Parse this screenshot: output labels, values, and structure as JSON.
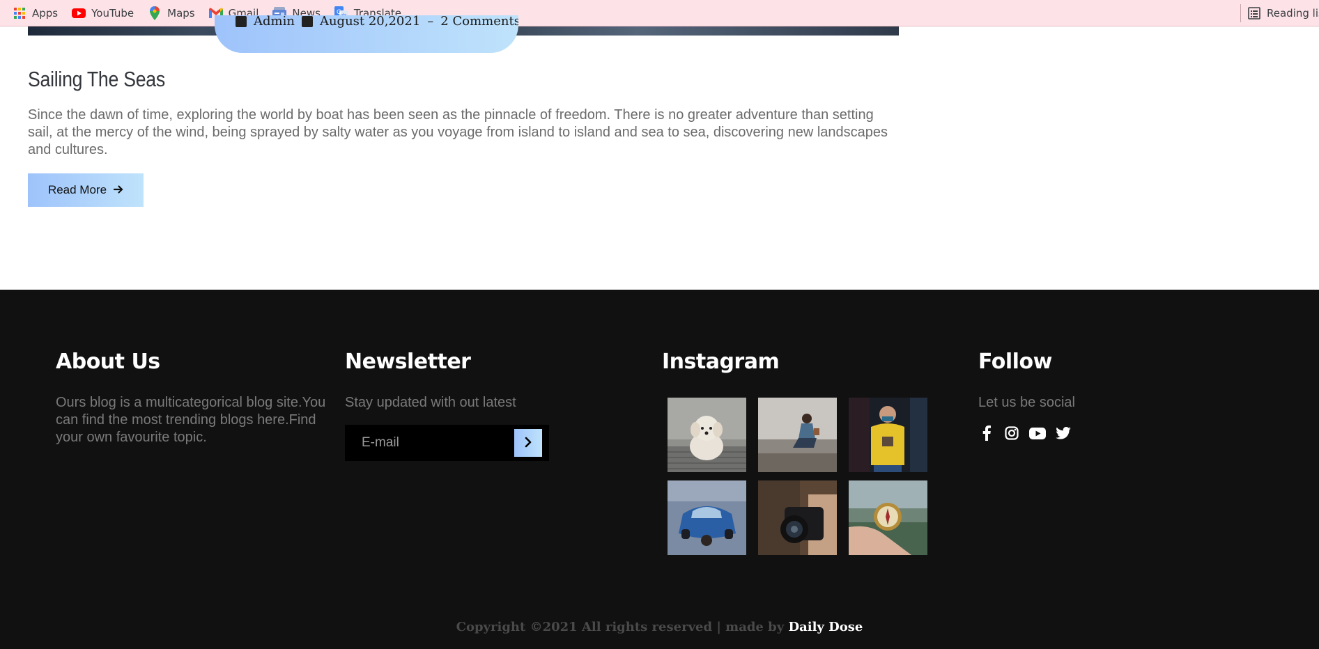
{
  "bookmarks": {
    "items": [
      {
        "label": "Apps",
        "icon": "apps-grid-icon"
      },
      {
        "label": "YouTube",
        "icon": "youtube-icon"
      },
      {
        "label": "Maps",
        "icon": "maps-pin-icon"
      },
      {
        "label": "Gmail",
        "icon": "gmail-icon"
      },
      {
        "label": "News",
        "icon": "news-icon"
      },
      {
        "label": "Translate",
        "icon": "translate-icon"
      }
    ],
    "reading_list": "Reading lis"
  },
  "post": {
    "meta": {
      "author": "Admin",
      "date": "August 20,2021",
      "comments": "2 Comments"
    },
    "title": "Sailing The Seas",
    "excerpt": "Since the dawn of time, exploring the world by boat has been seen as the pinnacle of freedom. There is no greater adventure than setting sail, at the mercy of the wind, being sprayed by salty water as you voyage from island to island and sea to sea, discovering new landscapes and cultures.",
    "read_more": "Read More"
  },
  "footer": {
    "about": {
      "heading": "About Us",
      "text": "Ours blog is a multicategorical blog site.You can find the most trending blogs here.Find your own favourite topic."
    },
    "newsletter": {
      "heading": "Newsletter",
      "text": "Stay updated with out latest",
      "placeholder": "E-mail"
    },
    "instagram": {
      "heading": "Instagram",
      "images": [
        "dog-photo",
        "woman-sitting-photo",
        "man-yellow-sweater-photo",
        "blue-car-photo",
        "camera-photo",
        "compass-photo"
      ]
    },
    "follow": {
      "heading": "Follow",
      "text": "Let us be social",
      "icons": [
        "facebook-icon",
        "instagram-icon",
        "youtube-icon",
        "twitter-icon"
      ]
    },
    "copyright": {
      "text": "Copyright ©2021 All rights reserved | made by",
      "brand": "Daily Dose"
    }
  },
  "colors": {
    "bookmark_bar": "#fde3e8",
    "accent_start": "#9ec3fb",
    "accent_end": "#bfe3fb",
    "footer_bg": "#111111"
  }
}
